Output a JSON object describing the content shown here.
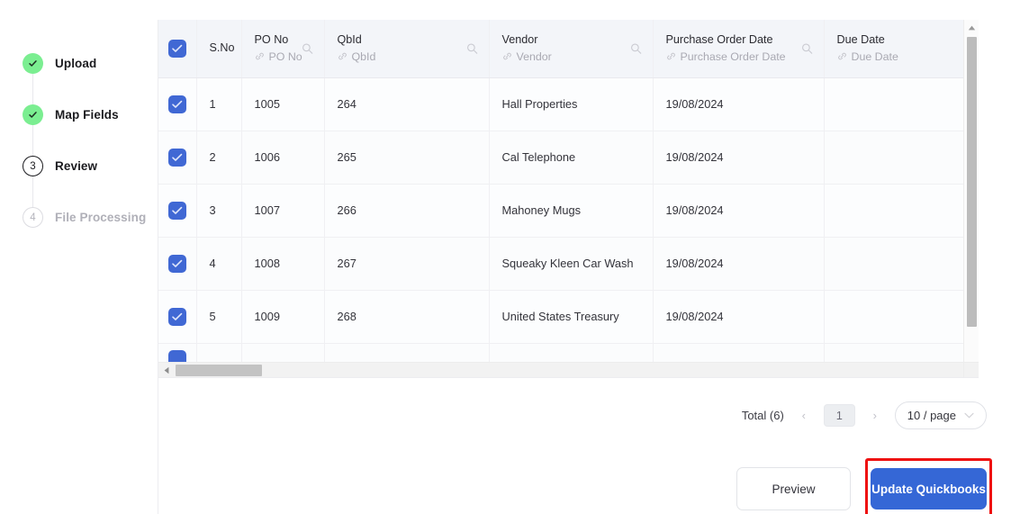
{
  "stepper": {
    "steps": [
      {
        "label": "Upload",
        "state": "done",
        "number": "1",
        "icon": "check-icon"
      },
      {
        "label": "Map Fields",
        "state": "done",
        "number": "2",
        "icon": "check-icon"
      },
      {
        "label": "Review",
        "state": "current",
        "number": "3",
        "icon": ""
      },
      {
        "label": "File Processing",
        "state": "pending",
        "number": "4",
        "icon": ""
      }
    ]
  },
  "table": {
    "select_all_checked": true,
    "columns": [
      {
        "key": "checkbox",
        "main": "",
        "sub": "",
        "has_search": false,
        "has_link": false
      },
      {
        "key": "sno",
        "main": "S.No",
        "sub": "",
        "has_search": false,
        "has_link": false
      },
      {
        "key": "pono",
        "main": "PO No",
        "sub": "PO No",
        "has_search": true,
        "has_link": true
      },
      {
        "key": "qbid",
        "main": "QbId",
        "sub": "QbId",
        "has_search": true,
        "has_link": true
      },
      {
        "key": "vendor",
        "main": "Vendor",
        "sub": "Vendor",
        "has_search": true,
        "has_link": true
      },
      {
        "key": "pod",
        "main": "Purchase Order Date",
        "sub": "Purchase Order Date",
        "has_search": true,
        "has_link": true
      },
      {
        "key": "due",
        "main": "Due Date",
        "sub": "Due Date",
        "has_search": true,
        "has_link": true
      }
    ],
    "rows": [
      {
        "checked": true,
        "sno": "1",
        "pono": "1005",
        "qbid": "264",
        "vendor": "Hall Properties",
        "pod": "19/08/2024",
        "due": ""
      },
      {
        "checked": true,
        "sno": "2",
        "pono": "1006",
        "qbid": "265",
        "vendor": "Cal Telephone",
        "pod": "19/08/2024",
        "due": ""
      },
      {
        "checked": true,
        "sno": "3",
        "pono": "1007",
        "qbid": "266",
        "vendor": "Mahoney Mugs",
        "pod": "19/08/2024",
        "due": ""
      },
      {
        "checked": true,
        "sno": "4",
        "pono": "1008",
        "qbid": "267",
        "vendor": "Squeaky Kleen Car Wash",
        "pod": "19/08/2024",
        "due": ""
      },
      {
        "checked": true,
        "sno": "5",
        "pono": "1009",
        "qbid": "268",
        "vendor": "United States Treasury",
        "pod": "19/08/2024",
        "due": ""
      }
    ]
  },
  "pagination": {
    "total_label": "Total (6)",
    "prev_glyph": "‹",
    "next_glyph": "›",
    "current_page": "1",
    "page_size": "10 / page"
  },
  "footer": {
    "preview_label": "Preview",
    "update_label": "Update Quickbooks"
  },
  "colors": {
    "primary_button": "#3567d6",
    "checkbox": "#4068d4",
    "step_done": "#7bee91",
    "highlight_box": "#ee1111",
    "header_bg": "#f3f5f9"
  }
}
